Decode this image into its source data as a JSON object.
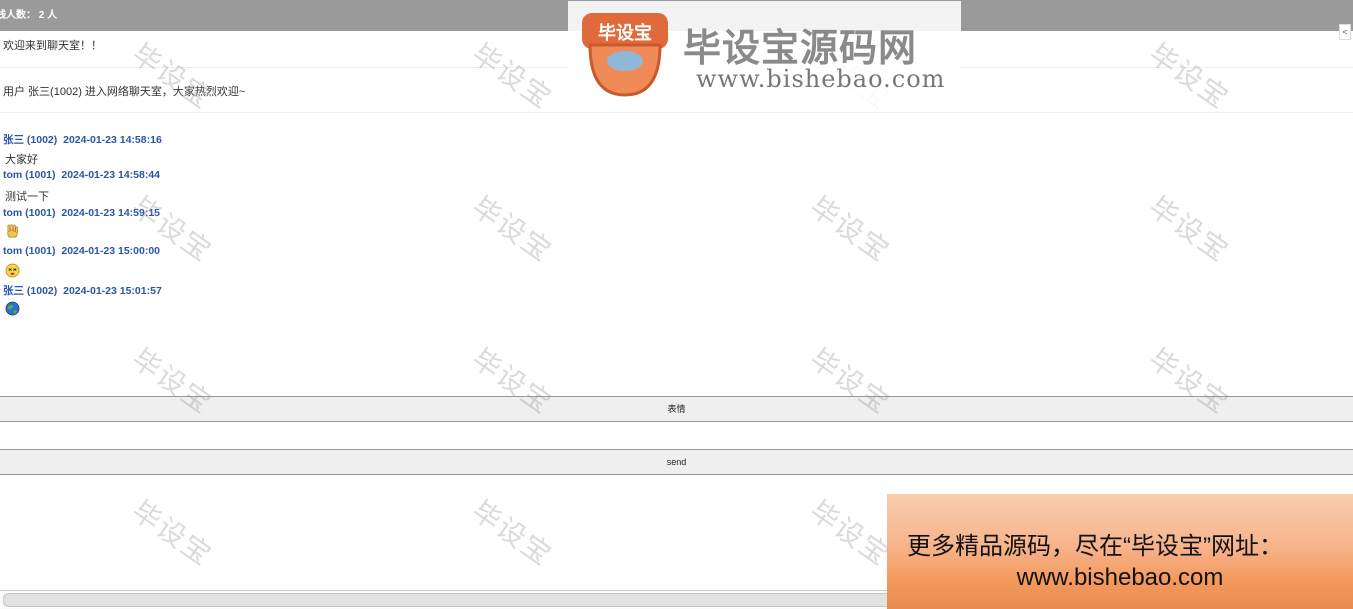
{
  "header": {
    "online_label": "线人数：",
    "online_count": "2 人",
    "side_tab": "<"
  },
  "system_messages": [
    "欢迎来到聊天室！！",
    "用户 张三(1002) 进入网络聊天室，大家热烈欢迎~"
  ],
  "messages": [
    {
      "sender": "张三 (1002)",
      "time": "2024-01-23 14:58:16",
      "text": "大家好",
      "emoji": ""
    },
    {
      "sender": "tom (1001)",
      "time": "2024-01-23 14:58:44",
      "text": "测试一下",
      "emoji": ""
    },
    {
      "sender": "tom (1001)",
      "time": "2024-01-23 14:59:15",
      "text": "",
      "emoji": "waving-hand-emoji"
    },
    {
      "sender": "tom (1001)",
      "time": "2024-01-23 15:00:00",
      "text": "",
      "emoji": "dizzy-face-emoji"
    },
    {
      "sender": "张三 (1002)",
      "time": "2024-01-23 15:01:57",
      "text": "",
      "emoji": "globe-emoji"
    }
  ],
  "controls": {
    "emoji_button": "表情",
    "send_button": "send",
    "input_value": ""
  },
  "watermark": "毕设宝",
  "logo": {
    "mark_text": "毕设宝",
    "title": "毕设宝源码网",
    "url": "www.bishebao.com"
  },
  "ad": {
    "line1": "更多精品源码，尽在“毕设宝”网址：",
    "line2": "www.bishebao.com"
  },
  "colors": {
    "header_bg": "#9a9a9a",
    "sender_color": "#2a56a8",
    "button_bg": "#efefef"
  }
}
